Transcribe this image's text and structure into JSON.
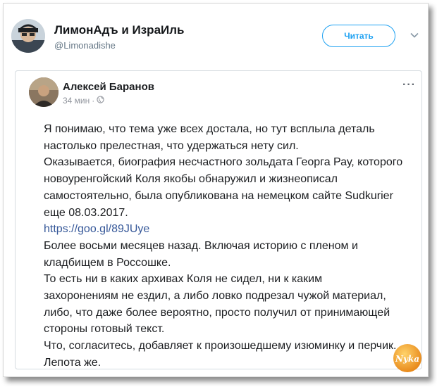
{
  "header": {
    "account_name": "ЛимонАдъ и ИзраИль",
    "handle": "@Limonadishe",
    "follow_label": "Читать"
  },
  "post": {
    "author": "Алексей Баранов",
    "time": "34 мин",
    "separator": "·",
    "more_label": "···",
    "lines": [
      "Я понимаю, что тема уже всех достала, но тут всплыла деталь",
      "настолько прелестная, что удержаться нету сил.",
      "Оказывается, биография несчастного зольдата Георга Рау, которого",
      "новоуренгойский Коля якобы обнаружил и жизнеописал",
      "самостоятельно, была опубликована на немецком сайте Sudkurier",
      "еще 08.03.2017.",
      "https://goo.gl/89JUye",
      "Более восьми месяцев назад. Включая историю с пленом и",
      "кладбищем в Россошке.",
      "То есть ни в каких архивах Коля не сидел, ни к каким",
      "захоронениям не ездил, а либо ловко подрезал чужой материал,",
      "либо, что даже более вероятно, просто получил от принимающей",
      "стороны готовый текст.",
      "Что, согласитесь, добавляет к произошедшему изюминку и перчик.",
      "Лепота же."
    ]
  },
  "watermark": {
    "text": "Nyka",
    "color": "#f2a51a"
  },
  "colors": {
    "accent": "#1da1f2",
    "link": "#365899"
  }
}
